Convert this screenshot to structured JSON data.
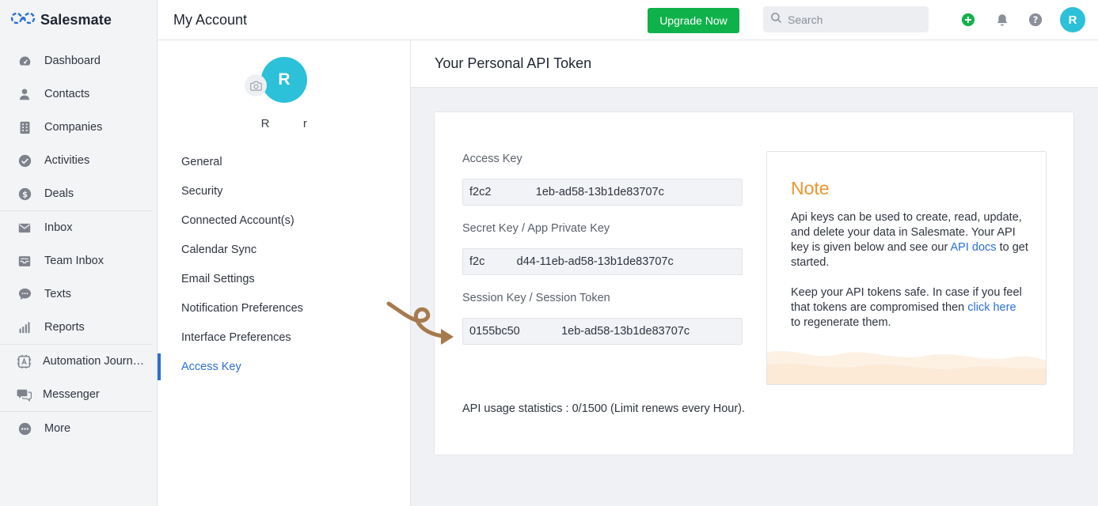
{
  "app": {
    "brand": "Salesmate"
  },
  "sidebar": {
    "items": [
      {
        "label": "Dashboard",
        "icon": "dashboard-icon"
      },
      {
        "label": "Contacts",
        "icon": "person-icon"
      },
      {
        "label": "Companies",
        "icon": "building-icon"
      },
      {
        "label": "Activities",
        "icon": "check-circle-icon"
      },
      {
        "label": "Deals",
        "icon": "dollar-icon"
      },
      {
        "label": "Inbox",
        "icon": "mail-icon"
      },
      {
        "label": "Team Inbox",
        "icon": "inbox-tray-icon"
      },
      {
        "label": "Texts",
        "icon": "chat-bubble-icon"
      },
      {
        "label": "Reports",
        "icon": "bar-chart-icon"
      },
      {
        "label": "Automation Journ…",
        "icon": "automation-icon"
      },
      {
        "label": "Messenger",
        "icon": "messenger-icon"
      },
      {
        "label": "More",
        "icon": "more-dots-icon"
      }
    ]
  },
  "header": {
    "title": "My Account",
    "upgrade_label": "Upgrade Now",
    "search_placeholder": "Search",
    "user_initial": "R"
  },
  "profile": {
    "initial": "R",
    "name": "R         r"
  },
  "settings_menu": {
    "items": [
      {
        "label": "General"
      },
      {
        "label": "Security"
      },
      {
        "label": "Connected Account(s)"
      },
      {
        "label": "Calendar Sync"
      },
      {
        "label": "Email Settings"
      },
      {
        "label": "Notification Preferences"
      },
      {
        "label": "Interface Preferences"
      },
      {
        "label": "Access Key"
      }
    ],
    "active": "Access Key"
  },
  "content": {
    "title": "Your Personal API Token",
    "access_key": {
      "label": "Access Key",
      "value": "f2c2              1eb-ad58-13b1de83707c"
    },
    "secret_key": {
      "label": "Secret Key / App Private Key",
      "value": "f2c          d44-11eb-ad58-13b1de83707c"
    },
    "session_key": {
      "label": "Session Key / Session Token",
      "value": "0155bc50             1eb-ad58-13b1de83707c"
    },
    "usage": "API usage statistics : 0/1500 (Limit renews every Hour)."
  },
  "note": {
    "title": "Note",
    "p1_before": "Api keys can be used to create, read, update, and delete your data in Salesmate. Your API key is given below and see our ",
    "p1_link": "API docs",
    "p1_after": " to get started.",
    "p2_before": "Keep your API tokens safe. In case if you feel that tokens are compromised then ",
    "p2_link": "click here",
    "p2_after": " to regenerate them."
  },
  "colors": {
    "accent": "#2a6fd6",
    "upgrade": "#0fb14a",
    "avatar": "#2cc0d9",
    "note_title": "#f0952e",
    "arrow": "#a57a4d"
  }
}
